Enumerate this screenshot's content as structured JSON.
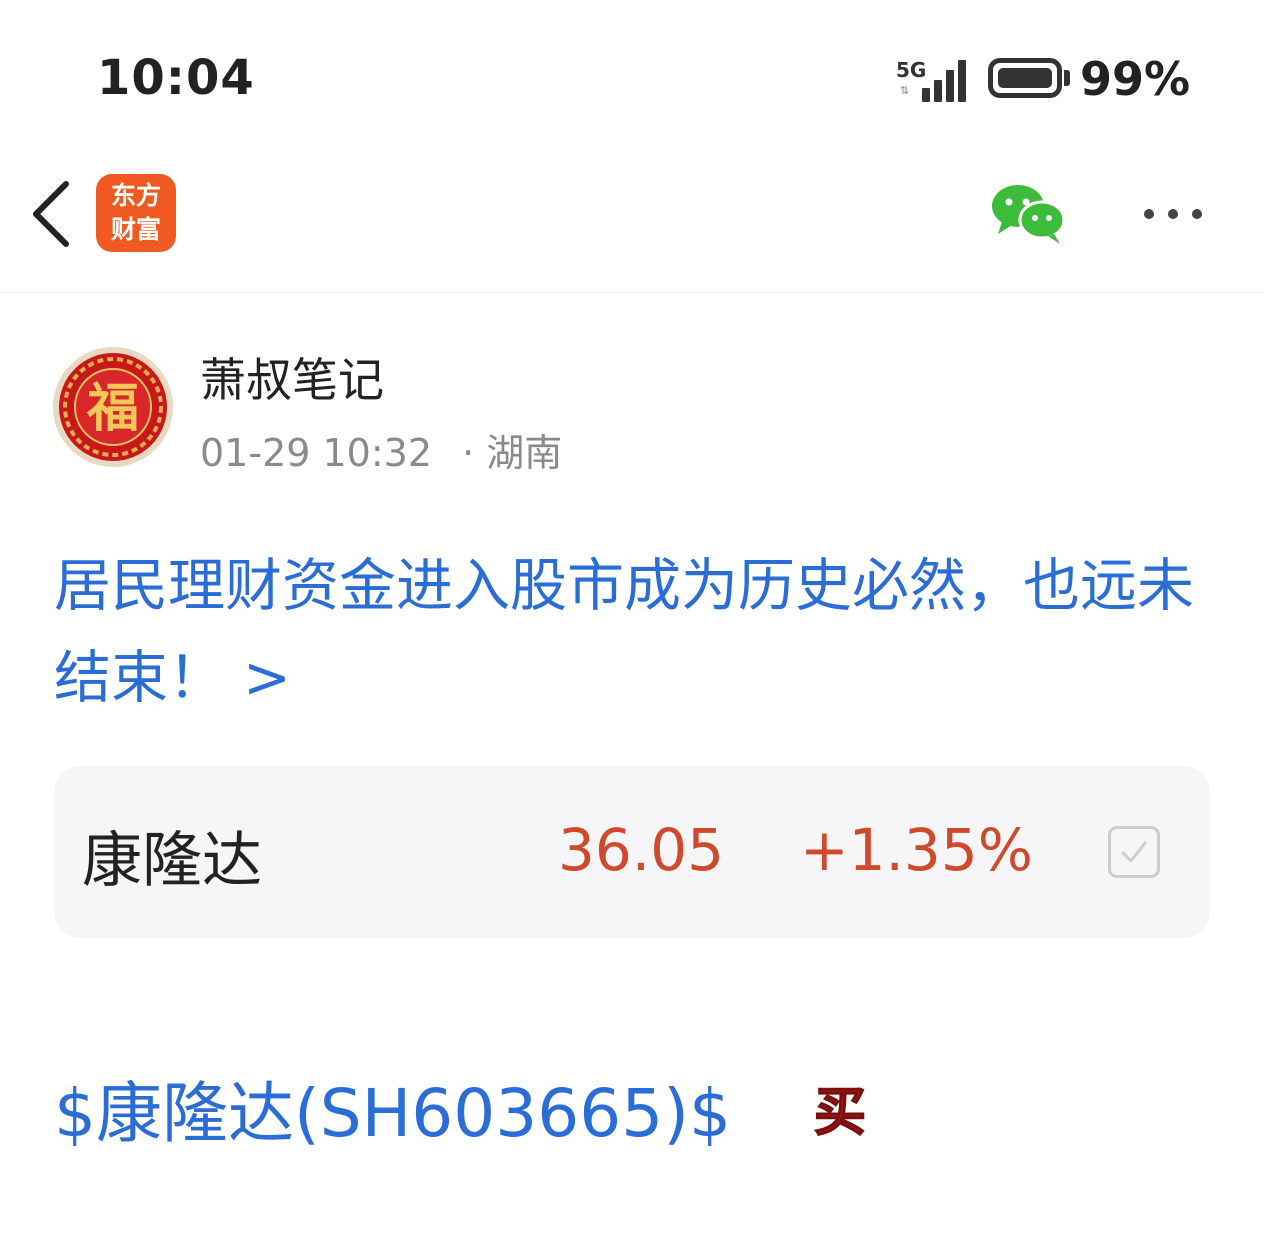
{
  "status_bar": {
    "time": "10:04",
    "network": "5G",
    "battery": "99%"
  },
  "nav": {
    "app_logo_line1": "东方",
    "app_logo_line2": "财富",
    "back_icon": "chevron-left-icon",
    "share_icon": "wechat-icon",
    "more_icon": "more-dots-icon",
    "brand_color": "#f05a22",
    "wechat_color": "#3dbb3b"
  },
  "author": {
    "name": "萧叔笔记",
    "datetime": "01-29 10:32",
    "location": "· 湖南"
  },
  "post": {
    "title": "居民理财资金进入股市成为历史必然，也远未结束！ >",
    "link_color": "#2b6dd6"
  },
  "stock_card": {
    "name": "康隆达",
    "price": "36.05",
    "change": "+1.35%",
    "up_color": "#cf4a2a"
  },
  "cashtag": {
    "text": "$康隆达(SH603665)$",
    "badge": "买"
  }
}
